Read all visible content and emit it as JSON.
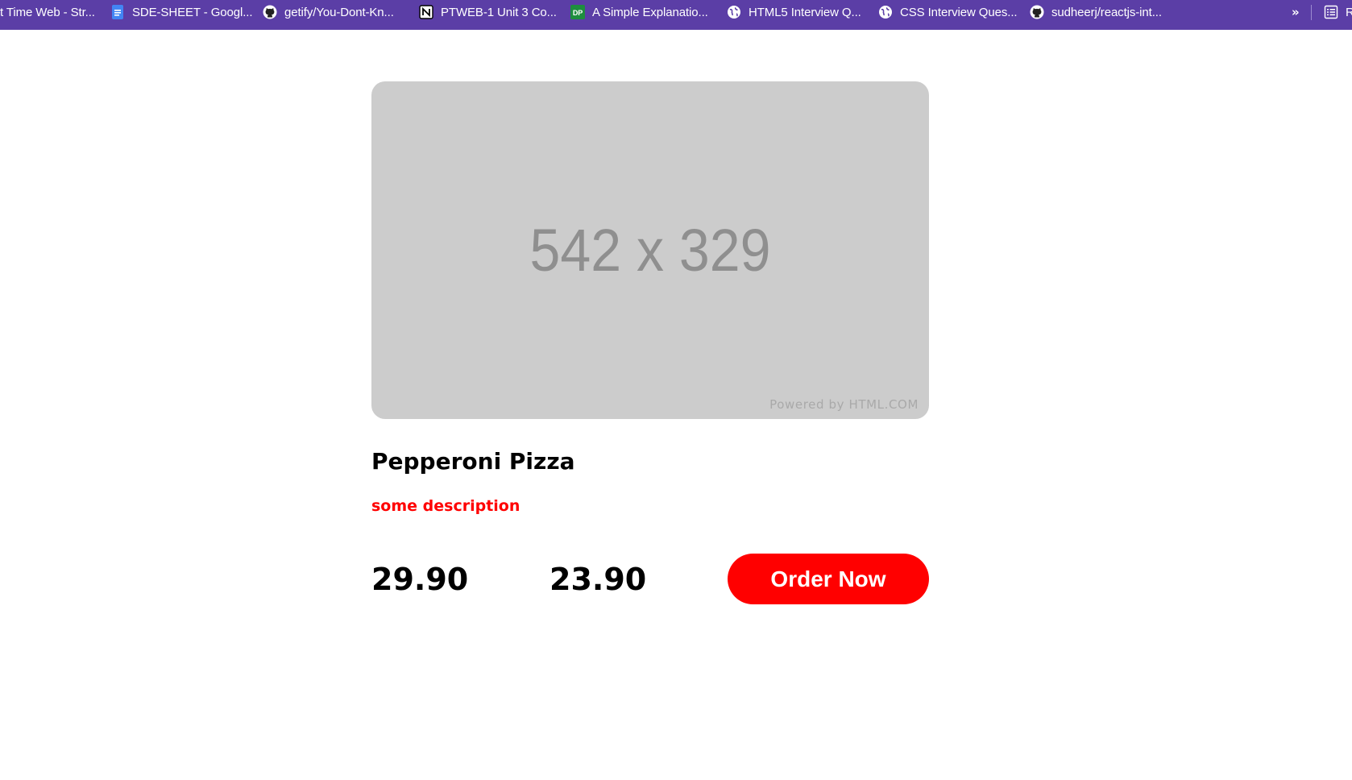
{
  "bookmarks": [
    {
      "label": "t Time Web - Str...",
      "icon": "none"
    },
    {
      "label": "SDE-SHEET - Googl...",
      "icon": "google-docs-icon",
      "color": "#4285f4"
    },
    {
      "label": "getify/You-Dont-Kn...",
      "icon": "github-icon"
    },
    {
      "label": "PTWEB-1 Unit 3 Co...",
      "icon": "notion-icon"
    },
    {
      "label": "A Simple Explanatio...",
      "icon": "dp-icon",
      "color": "#1e8e3e"
    },
    {
      "label": "HTML5 Interview Q...",
      "icon": "globe-icon"
    },
    {
      "label": "CSS Interview Ques...",
      "icon": "globe-icon"
    },
    {
      "label": "sudheerj/reactjs-int...",
      "icon": "github-icon"
    }
  ],
  "overflow_label": "»",
  "reading_list_label": "R",
  "product": {
    "image_dims": "542 x 329",
    "image_watermark": "Powered by HTML.COM",
    "title": "Pepperoni Pizza",
    "description": "some description",
    "price_original": "29.90",
    "price_sale": "23.90",
    "order_label": "Order Now"
  },
  "colors": {
    "bookmarks_bar": "#5b3ea6",
    "accent": "#ff0000",
    "placeholder": "#cccccc"
  }
}
